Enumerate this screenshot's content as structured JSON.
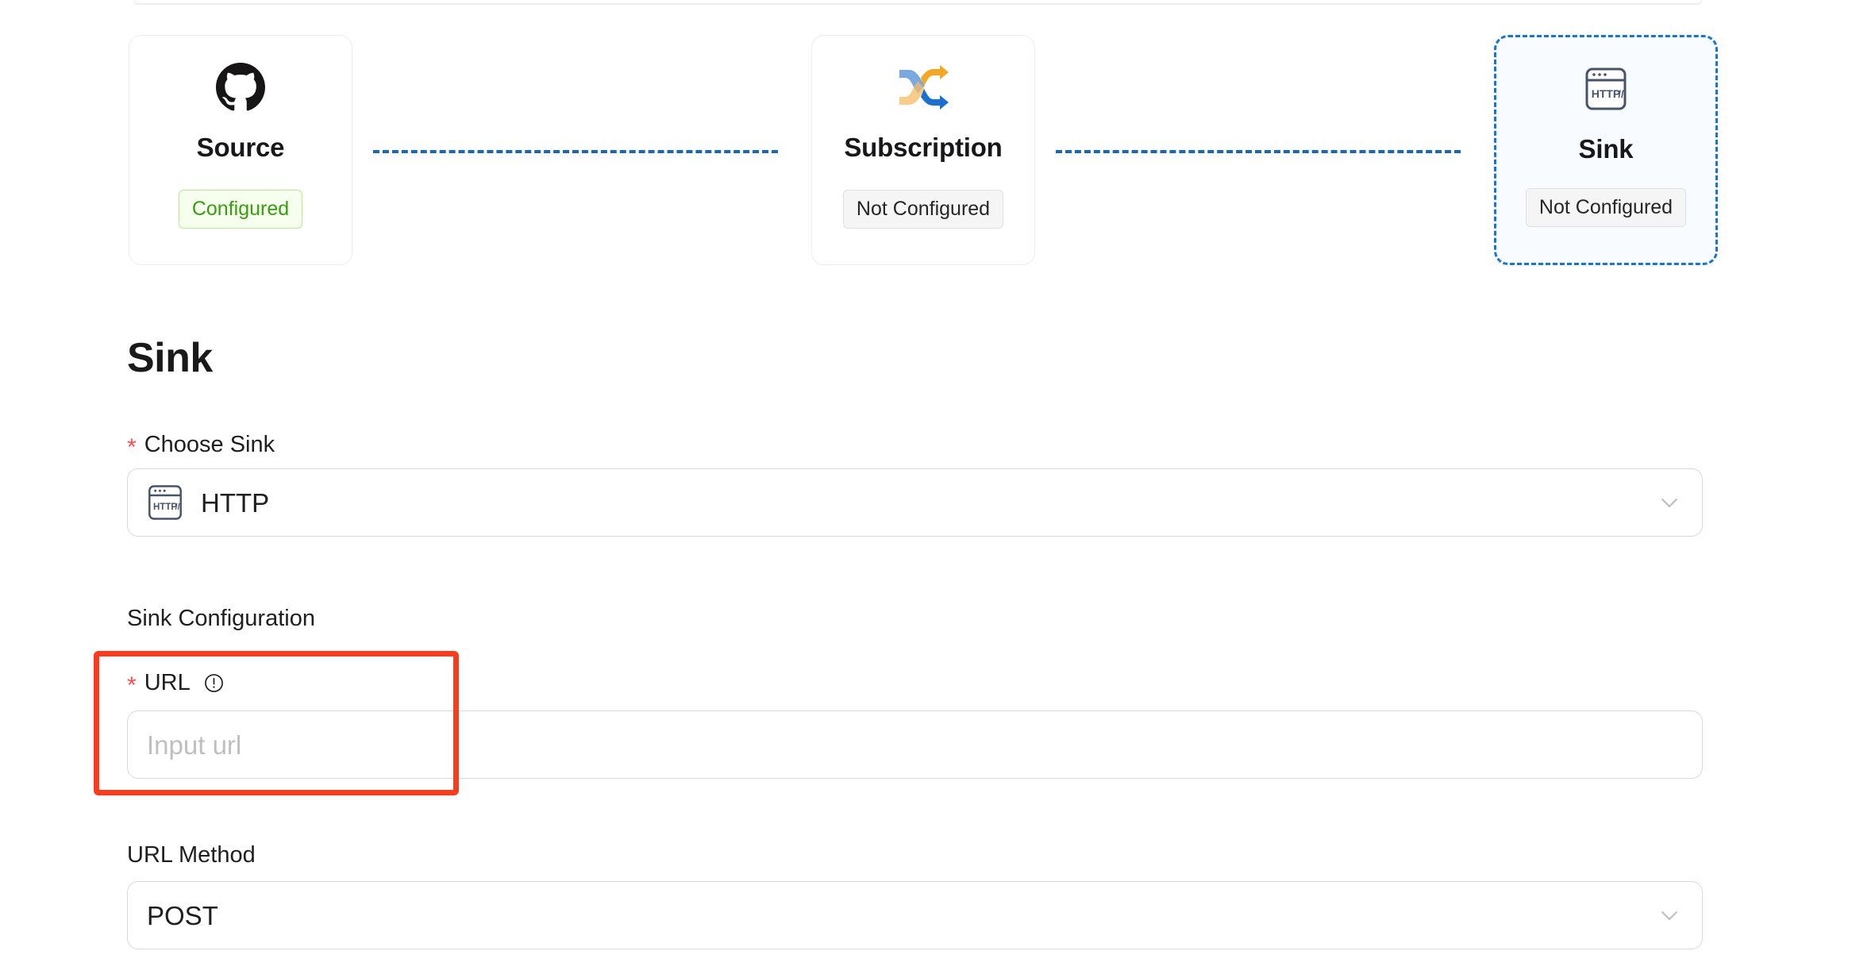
{
  "flow": {
    "steps": [
      {
        "name": "source",
        "title": "Source",
        "icon": "github-icon",
        "status": "Configured",
        "status_kind": "configured",
        "active": false
      },
      {
        "name": "subscription",
        "title": "Subscription",
        "icon": "shuffle-icon",
        "status": "Not Configured",
        "status_kind": "not-configured",
        "active": false
      },
      {
        "name": "sink",
        "title": "Sink",
        "icon": "http-icon",
        "status": "Not Configured",
        "status_kind": "not-configured",
        "active": true
      }
    ]
  },
  "form": {
    "heading": "Sink",
    "choose_sink": {
      "label": "Choose Sink",
      "required_mark": "*",
      "value": "HTTP",
      "icon": "http-icon",
      "chevron": "chevron-down-icon"
    },
    "sink_configuration_label": "Sink Configuration",
    "url": {
      "label": "URL",
      "required_mark": "*",
      "info_icon": "exclamation-circle-icon",
      "placeholder": "Input url",
      "value": ""
    },
    "url_method": {
      "label": "URL Method",
      "value": "POST",
      "chevron": "chevron-down-icon"
    }
  },
  "colors": {
    "accent_blue": "#1677d2",
    "connector_blue": "#1668b8",
    "success_green": "#389e0d",
    "success_bg": "#f6ffed",
    "annotation_red": "#fb3b1e",
    "required_red": "#ff4d4f",
    "placeholder_gray": "#bfbfbf"
  }
}
